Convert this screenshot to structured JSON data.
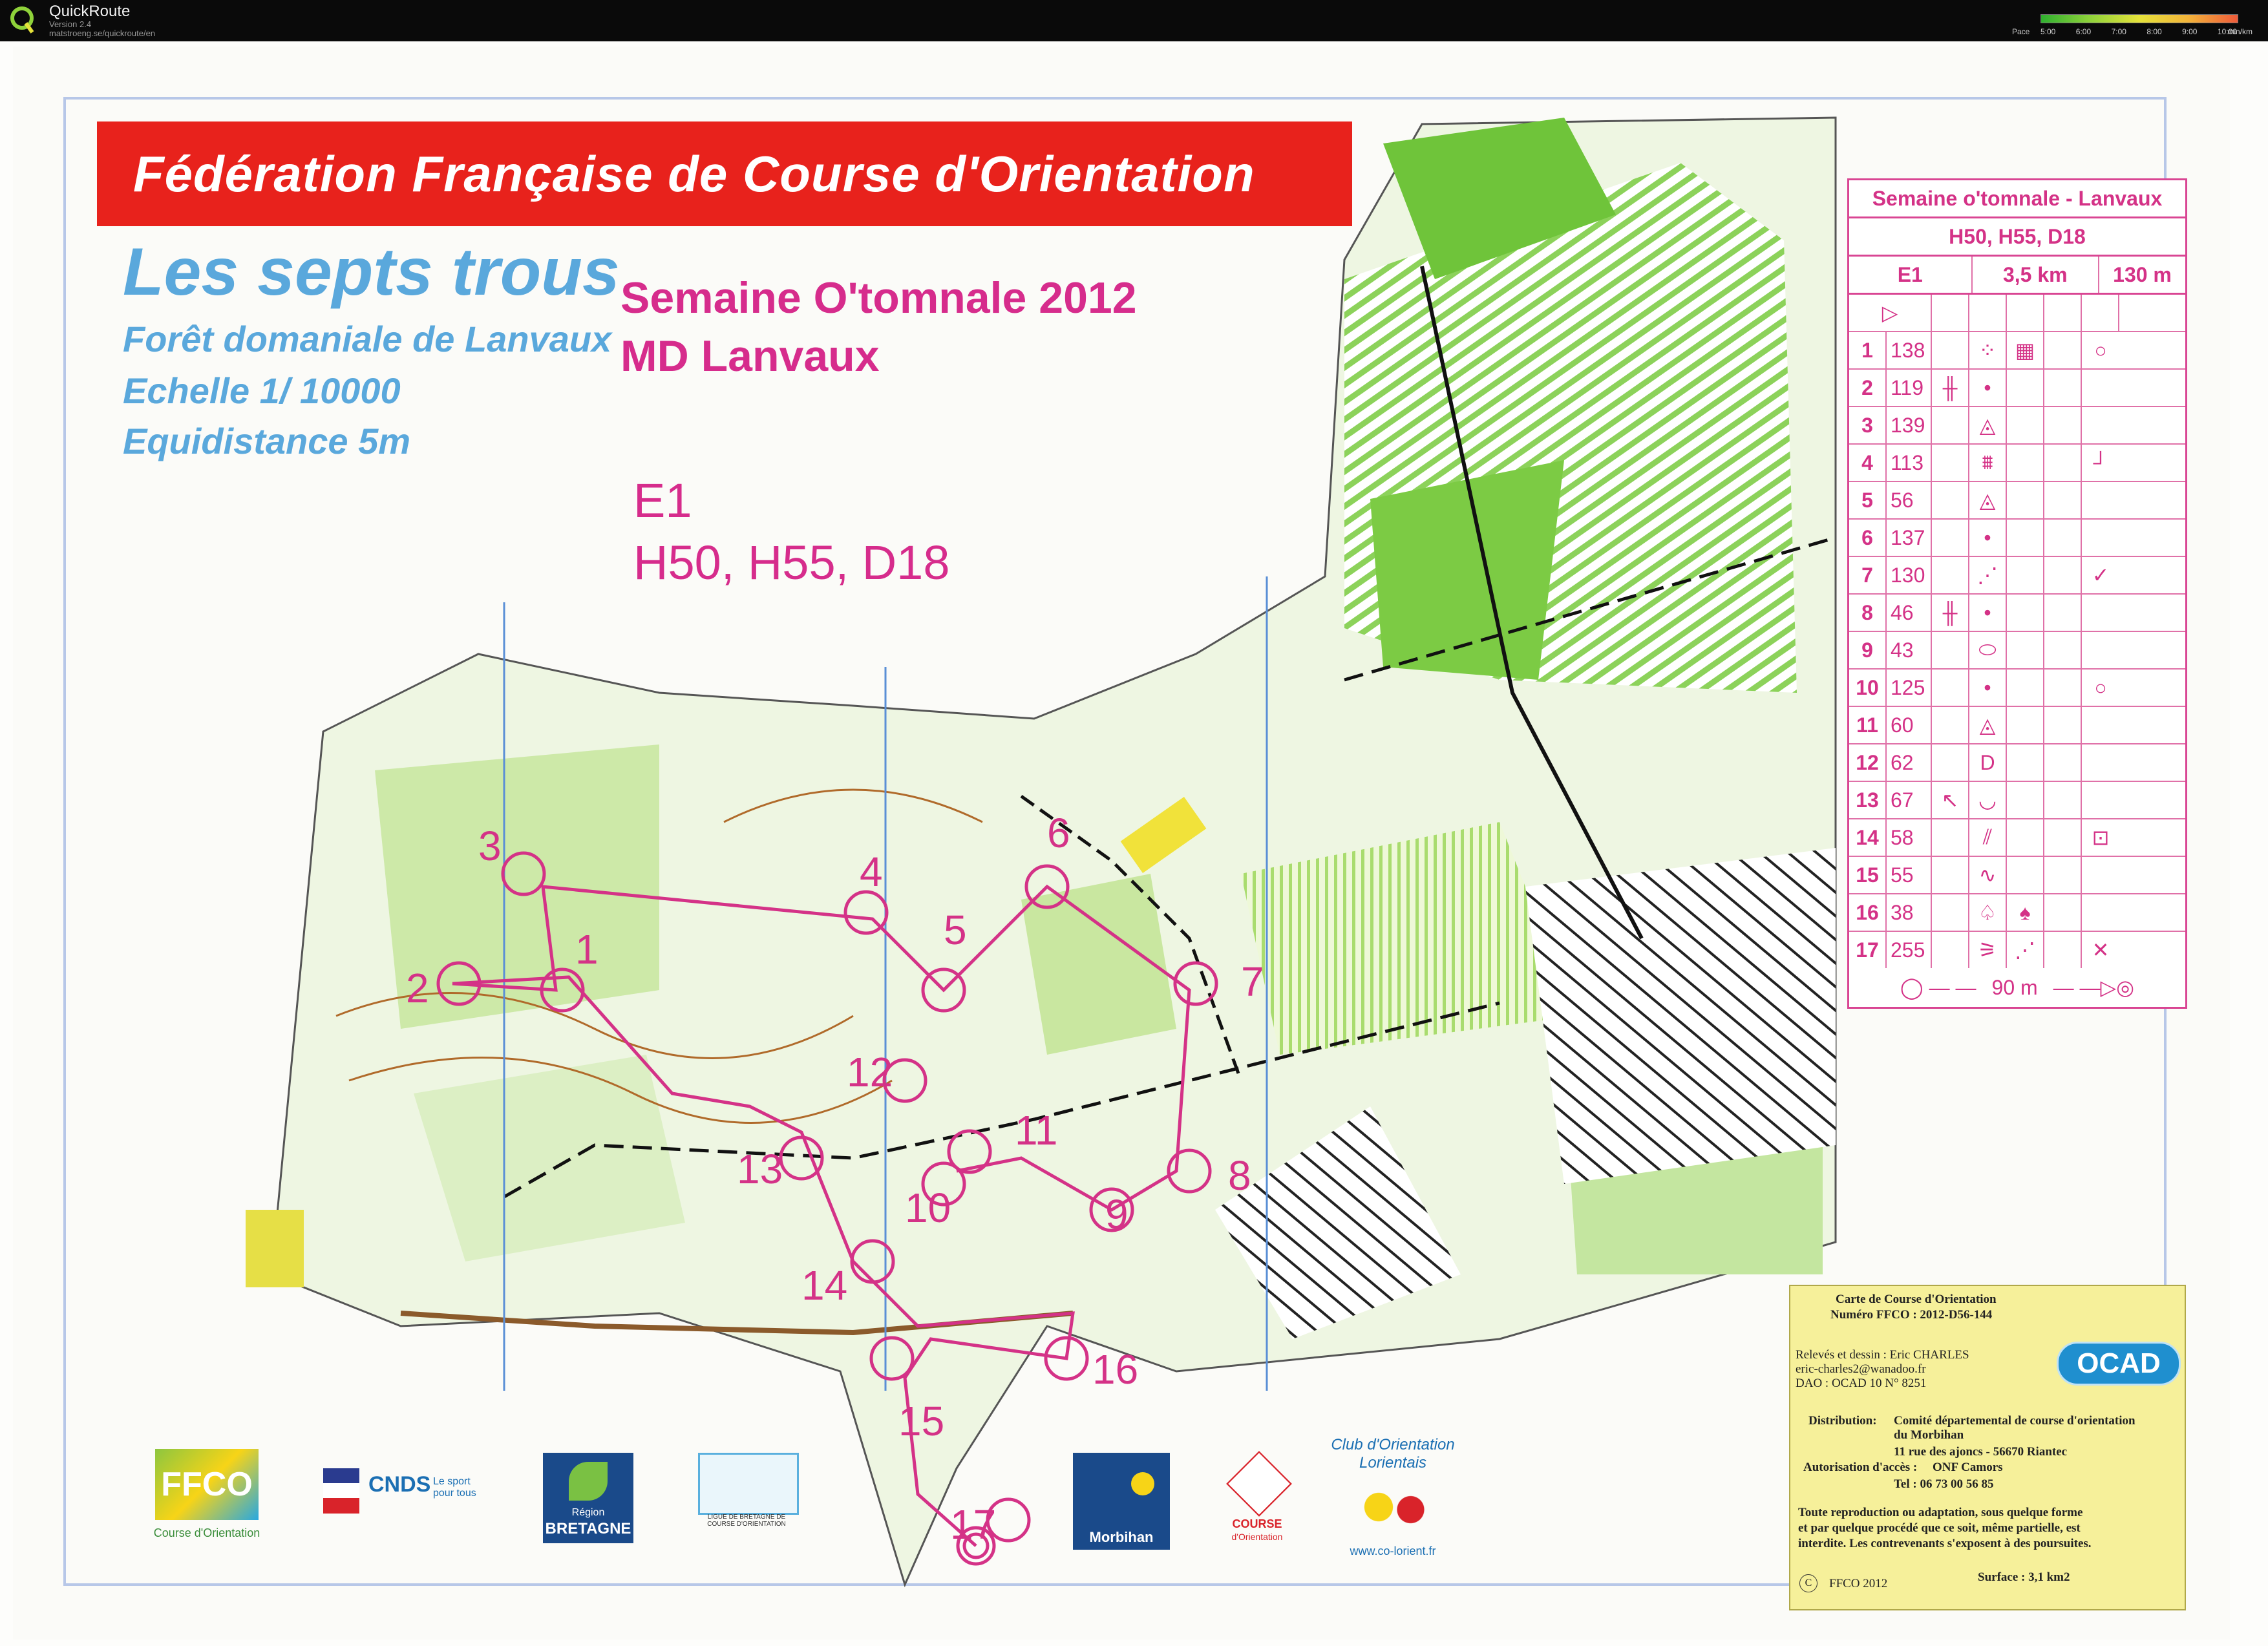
{
  "app": {
    "title": "QuickRoute",
    "version": "Version 2.4",
    "url": "matstroeng.se/quickroute/en",
    "icon": "quickroute-logo-icon"
  },
  "pace_legend": {
    "label": "Pace",
    "ticks": [
      "5:00",
      "6:00",
      "7:00",
      "8:00",
      "9:00",
      "10:00"
    ],
    "unit": "min/km",
    "colors": [
      "#2fb02f",
      "#8fd23a",
      "#e5e23a",
      "#f2b33a",
      "#ef5b3a"
    ]
  },
  "map": {
    "federation": "Fédération Française de Course d'Orientation",
    "name": "Les septs trous",
    "forest": "Forêt domaniale de Lanvaux",
    "scale": "Echelle  1/ 10000",
    "equidistance": "Equidistance  5m",
    "event_line1": "Semaine O'tomnale 2012",
    "event_line2": "MD Lanvaux",
    "course": "E1",
    "categories": "H50, H55, D18",
    "course_color": "#d43287",
    "banner_color": "#e8221c",
    "title_color": "#5aa8dc"
  },
  "control_description": {
    "title": "Semaine o'tomnale - Lanvaux",
    "categories": "H50, H55, D18",
    "course": "E1",
    "length": "3,5 km",
    "climb": "130 m",
    "start_symbol": "▷",
    "controls": [
      {
        "n": "1",
        "code": "138",
        "s1": "",
        "s2": "⁘",
        "s3": "▦",
        "s4": "○"
      },
      {
        "n": "2",
        "code": "119",
        "s1": "╫",
        "s2": "•",
        "s3": "",
        "s4": ""
      },
      {
        "n": "3",
        "code": "139",
        "s1": "",
        "s2": "◬",
        "s3": "",
        "s4": ""
      },
      {
        "n": "4",
        "code": "113",
        "s1": "",
        "s2": "⩩",
        "s3": "",
        "s4": "┘"
      },
      {
        "n": "5",
        "code": "56",
        "s1": "",
        "s2": "◬",
        "s3": "",
        "s4": ""
      },
      {
        "n": "6",
        "code": "137",
        "s1": "",
        "s2": "•",
        "s3": "",
        "s4": ""
      },
      {
        "n": "7",
        "code": "130",
        "s1": "",
        "s2": "⋰",
        "s3": "",
        "s4": "✓"
      },
      {
        "n": "8",
        "code": "46",
        "s1": "╫",
        "s2": "•",
        "s3": "",
        "s4": ""
      },
      {
        "n": "9",
        "code": "43",
        "s1": "",
        "s2": "⬭",
        "s3": "",
        "s4": ""
      },
      {
        "n": "10",
        "code": "125",
        "s1": "",
        "s2": "•",
        "s3": "",
        "s4": "○"
      },
      {
        "n": "11",
        "code": "60",
        "s1": "",
        "s2": "◬",
        "s3": "",
        "s4": ""
      },
      {
        "n": "12",
        "code": "62",
        "s1": "",
        "s2": "D",
        "s3": "",
        "s4": ""
      },
      {
        "n": "13",
        "code": "67",
        "s1": "↖",
        "s2": "◡",
        "s3": "",
        "s4": ""
      },
      {
        "n": "14",
        "code": "58",
        "s1": "",
        "s2": "⫽",
        "s3": "",
        "s4": "⊡"
      },
      {
        "n": "15",
        "code": "55",
        "s1": "",
        "s2": "∿",
        "s3": "",
        "s4": ""
      },
      {
        "n": "16",
        "code": "38",
        "s1": "",
        "s2": "♤",
        "s3": "♠",
        "s4": ""
      },
      {
        "n": "17",
        "code": "255",
        "s1": "",
        "s2": "⚞",
        "s3": "⋰",
        "s4": "✕"
      }
    ],
    "finish_distance": "90 m"
  },
  "info_box": {
    "title": "Carte de Course d'Orientation",
    "number": "Numéro FFCO : 2012-D56-144",
    "survey": "Relevés et dessin : Eric CHARLES",
    "email": "eric-charles2@wanadoo.fr",
    "dao": "DAO : OCAD 10  N° 8251",
    "distribution_label": "Distribution:",
    "distribution": "Comité départemental de course d'orientation",
    "distribution2": "du Morbihan",
    "address": "11 rue des ajoncs  -  56670  Riantec",
    "access_label": "Autorisation d'accès :",
    "access": "ONF Camors",
    "phone": "Tel : 06 73 00 56 85",
    "notice1": "Toute reproduction ou adaptation, sous quelque forme",
    "notice2": "et par quelque procédé  que ce soit, même partielle, est",
    "notice3": "interdite. Les contrevenants s'exposent à des poursuites.",
    "copyright": "FFCO 2012",
    "copyright_mark": "C",
    "surface": "Surface : 3,1 km2",
    "ocad": "OCAD"
  },
  "control_numbers": [
    "1",
    "2",
    "3",
    "4",
    "5",
    "6",
    "7",
    "8",
    "9",
    "10",
    "11",
    "12",
    "13",
    "14",
    "15",
    "16",
    "17"
  ],
  "logos": {
    "ffco": "FFCO",
    "ffco_sub": "Course d'Orientation",
    "cnds": "CNDS",
    "cnds_sub": "Le sport pour tous",
    "region": "Région",
    "region2": "BRETAGNE",
    "ligue": "LIGUE DE BRETAGNE DE COURSE D'ORIENTATION",
    "morbihan": "Morbihan",
    "course_cd": "COURSE",
    "course_cd2": "d'Orientation",
    "club": "Club d'Orientation Lorientais",
    "club_url": "www.co-lorient.fr"
  }
}
